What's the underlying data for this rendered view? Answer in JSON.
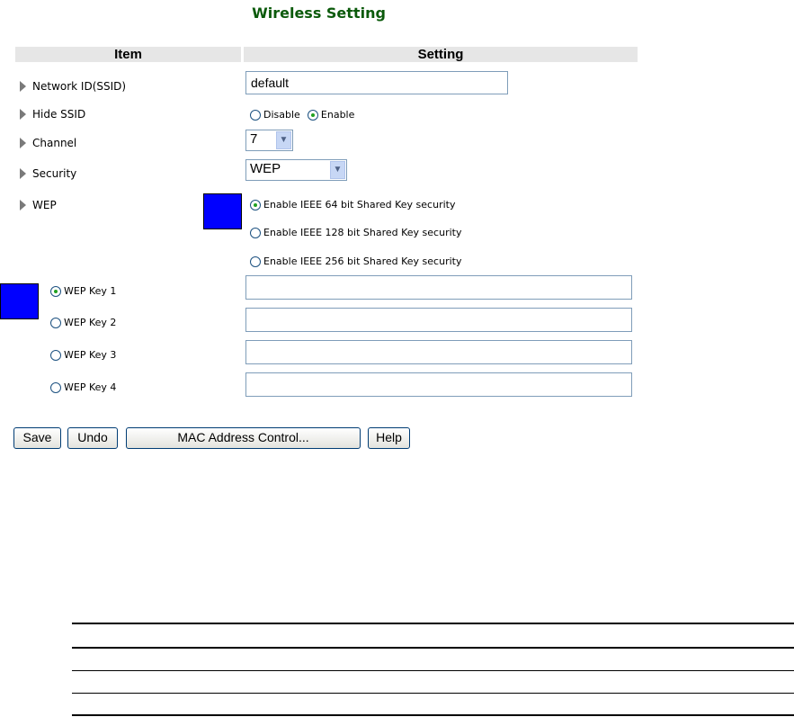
{
  "page": {
    "title": "Wireless Setting"
  },
  "table": {
    "col_item": "Item",
    "col_setting": "Setting"
  },
  "fields": {
    "ssid": {
      "label": "Network ID(SSID)",
      "value": "default"
    },
    "hide_ssid": {
      "label": "Hide SSID",
      "options": [
        "Disable",
        "Enable"
      ],
      "selected": "Enable"
    },
    "channel": {
      "label": "Channel",
      "value": "7"
    },
    "security": {
      "label": "Security",
      "value": "WEP"
    },
    "wep": {
      "label": "WEP",
      "options": [
        "Enable IEEE 64 bit Shared Key security",
        "Enable IEEE 128 bit Shared Key security",
        "Enable IEEE 256 bit Shared Key security"
      ],
      "selected_index": 0
    },
    "wep_keys": {
      "labels": [
        "WEP Key 1",
        "WEP Key 2",
        "WEP Key 3",
        "WEP Key 4"
      ],
      "values": [
        "",
        "",
        "",
        ""
      ],
      "selected_index": 0
    }
  },
  "buttons": {
    "save": "Save",
    "undo": "Undo",
    "mac": "MAC Address Control...",
    "help": "Help"
  },
  "colors": {
    "title": "#0b5a0b",
    "header_bg": "#e6e6e6",
    "marker": "#0000ff"
  },
  "icons": {
    "row_marker": "triangle-right-icon",
    "dropdown": "chevron-down-icon"
  }
}
